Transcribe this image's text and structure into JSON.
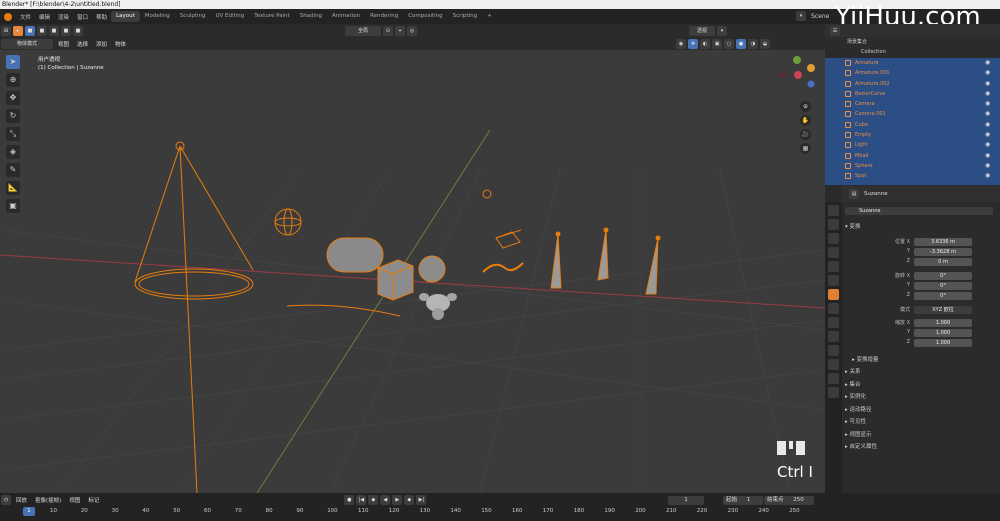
{
  "titlebar": {
    "title": "Blender* [F:\\blender\\4-2\\untitled.blend]"
  },
  "menu": {
    "items": [
      "文件",
      "编辑",
      "渲染",
      "窗口",
      "帮助"
    ]
  },
  "workspaces": [
    "Layout",
    "Modeling",
    "Sculpting",
    "UV Editing",
    "Texture Paint",
    "Shading",
    "Animation",
    "Rendering",
    "Compositing",
    "Scripting",
    "+"
  ],
  "scene_label": "Scene",
  "watermark": "YiiHuu.com",
  "viewport_header": {
    "mode": "物体模式",
    "menus": [
      "视图",
      "选择",
      "添加",
      "物体"
    ],
    "transform_orientation": "全局",
    "view_layer": "透视"
  },
  "viewport_info": {
    "line1": "用户透视",
    "line2": "(1) Collection | Suzanne"
  },
  "shortcut_overlay": "Ctrl I",
  "outliner": {
    "title": "场景集合",
    "collection": "Collection",
    "items": [
      "Armature",
      "Armature.001",
      "Armature.002",
      "BezierCurve",
      "Camera",
      "Camera.001",
      "Cube",
      "Empty",
      "Light",
      "Mball",
      "Sphere",
      "Spot"
    ]
  },
  "properties": {
    "object_name": "Suzanne",
    "object_field": "Suzanne",
    "section_transform": "变换",
    "location_label": "位置 X",
    "location": [
      "3.6336 m",
      "-3.3628 m",
      "0 m"
    ],
    "rotation_label": "旋转 X",
    "rotation": [
      "0°",
      "0°",
      "0°"
    ],
    "mode_label": "模式",
    "mode_value": "XYZ 欧拉",
    "scale_label": "缩放 X",
    "scale": [
      "1.000",
      "1.000",
      "1.000"
    ],
    "axis_y": "Y",
    "axis_z": "Z",
    "delta": "变换增量",
    "sections": [
      "关系",
      "集合",
      "实例化",
      "运动路径",
      "可见性",
      "视图显示",
      "自定义属性"
    ]
  },
  "timeline": {
    "menus": [
      "回放",
      "抠像(插帧)",
      "视图",
      "标记"
    ],
    "current_frame": "1",
    "start_label": "起始",
    "start": "1",
    "end_label": "结束点",
    "end": "250",
    "ruler": [
      "1",
      "10",
      "20",
      "30",
      "40",
      "50",
      "60",
      "70",
      "80",
      "90",
      "100",
      "110",
      "120",
      "130",
      "140",
      "150",
      "160",
      "170",
      "180",
      "190",
      "200",
      "210",
      "220",
      "230",
      "240",
      "250"
    ]
  },
  "colors": {
    "selected": "#e87d0d",
    "accent_blue": "#4772b3",
    "x_axis": "#9c3b47"
  }
}
